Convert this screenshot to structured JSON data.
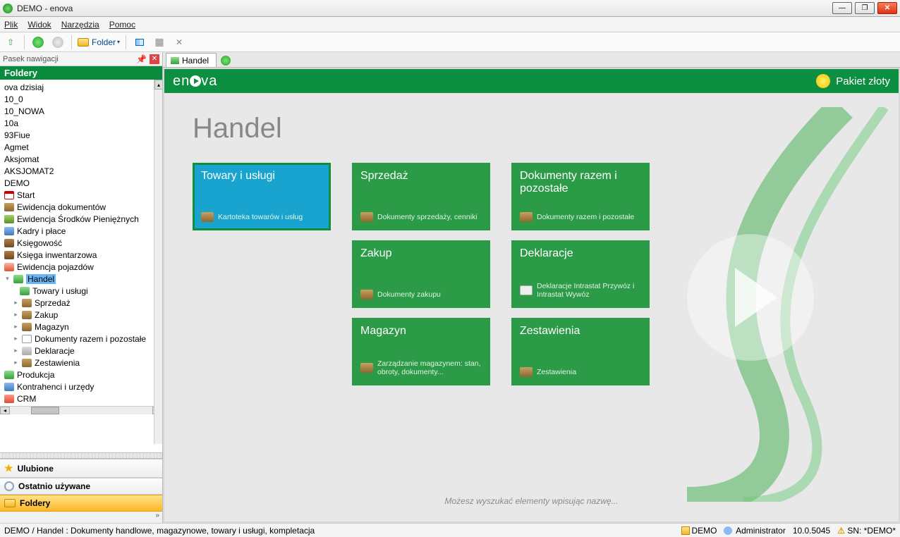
{
  "window": {
    "title": "DEMO - enova"
  },
  "menu": {
    "file": "Plik",
    "view": "Widok",
    "tools": "Narzędzia",
    "help": "Pomoc"
  },
  "toolbar": {
    "folder": "Folder"
  },
  "nav": {
    "panel_title": "Pasek nawigacji",
    "section_title": "Foldery",
    "items_top": [
      "ova dzisiaj",
      "10_0",
      "10_NOWA",
      "10a",
      "93Fiue",
      "Agmet",
      "Aksjomat",
      "AKSJOMAT2",
      "DEMO"
    ],
    "start": "Start",
    "modules": [
      "Ewidencja dokumentów",
      "Ewidencja Środków Pieniężnych",
      "Kadry i płace",
      "Księgowość",
      "Księga inwentarzowa",
      "Ewidencja pojazdów"
    ],
    "handel": "Handel",
    "handel_children": [
      "Towary i usługi",
      "Sprzedaż",
      "Zakup",
      "Magazyn",
      "Dokumenty razem i pozostałe",
      "Deklaracje",
      "Zestawienia"
    ],
    "modules2": [
      "Produkcja",
      "Kontrahenci i urzędy",
      "CRM"
    ],
    "tab_ulubione": "Ulubione",
    "tab_ostatnio": "Ostatnio używane",
    "tab_foldery": "Foldery"
  },
  "tab": {
    "label": "Handel"
  },
  "brand": {
    "logo_pre": "en",
    "logo_post": "va",
    "package": "Pakiet złoty"
  },
  "page": {
    "title": "Handel",
    "search_hint": "Możesz wyszukać elementy wpisując nazwę..."
  },
  "tiles": {
    "towary": {
      "title": "Towary i usługi",
      "sub": "Kartoteka towarów i usług"
    },
    "sprzedaz": {
      "title": "Sprzedaż",
      "sub": "Dokumenty sprzedaży, cenniki"
    },
    "zakup": {
      "title": "Zakup",
      "sub": "Dokumenty zakupu"
    },
    "magazyn": {
      "title": "Magazyn",
      "sub": "Zarządzanie magazynem: stan, obroty, dokumenty..."
    },
    "dokumenty": {
      "title": "Dokumenty razem i pozostałe",
      "sub": "Dokumenty razem i pozostałe"
    },
    "deklaracje": {
      "title": "Deklaracje",
      "sub": "Deklaracje Intrastat Przywóz i Intrastat Wywóz"
    },
    "zestawienia": {
      "title": "Zestawienia",
      "sub": "Zestawienia"
    }
  },
  "status": {
    "path": "DEMO / Handel : Dokumenty handlowe, magazynowe, towary i usługi, kompletacja",
    "db": "DEMO",
    "user": "Administrator",
    "version": "10.0.5045",
    "sn": "SN: *DEMO*"
  }
}
